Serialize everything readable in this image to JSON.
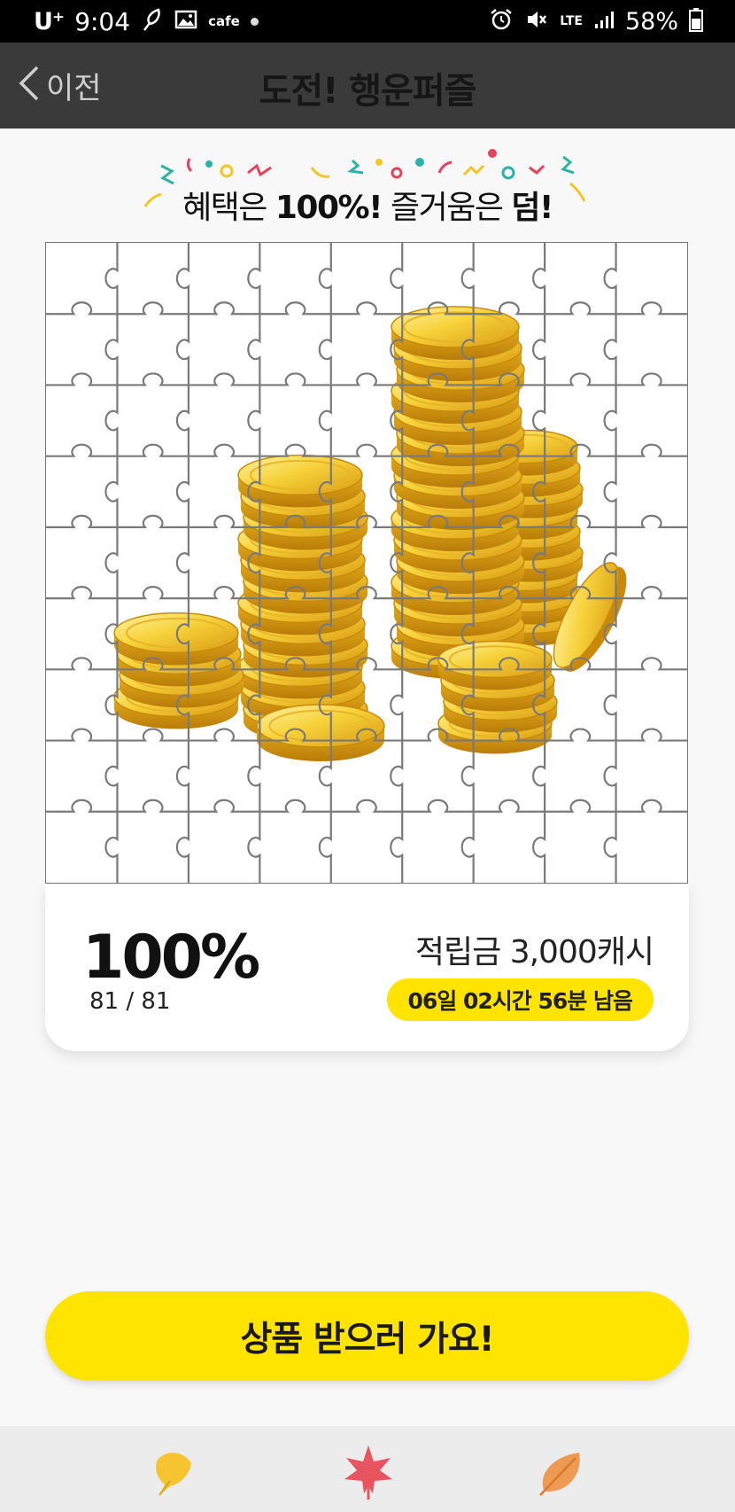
{
  "status_bar": {
    "carrier": "U⁺",
    "time": "9:04",
    "cafe_label": "cafe",
    "network": "LTE",
    "battery": "58%"
  },
  "header": {
    "back_label": "이전",
    "title": "도전! 행운퍼즐"
  },
  "banner": {
    "part1": "혜택은 ",
    "part2": "100%!",
    "part3": " 즐거움은 ",
    "part4": "덤!"
  },
  "puzzle": {
    "rows": 9,
    "cols": 9,
    "image": "gold-coins"
  },
  "progress": {
    "percent": "100%",
    "count": "81 / 81",
    "reward": "적립금 3,000캐시",
    "time_left": "06일 02시간 56분 남음"
  },
  "cta": {
    "label": "상품 받으러 가요!"
  },
  "bottom_nav": [
    {
      "icon": "ginkgo-leaf-icon",
      "color": "#f5c531"
    },
    {
      "icon": "maple-leaf-icon",
      "color": "#e85560"
    },
    {
      "icon": "autumn-leaf-icon",
      "color": "#ef9a52"
    }
  ]
}
